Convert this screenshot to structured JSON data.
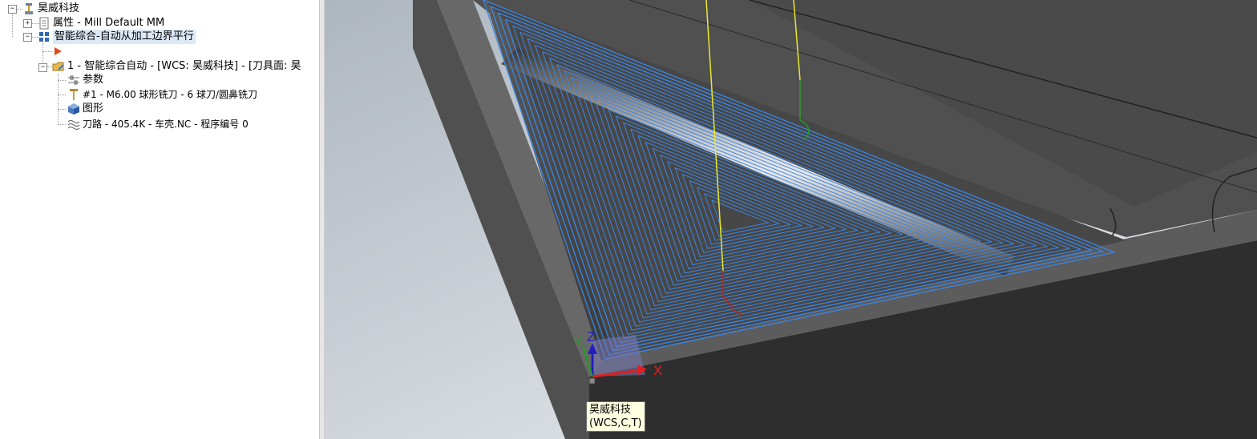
{
  "tree": {
    "root": {
      "label": "昊威科技",
      "icon": "machine-icon"
    },
    "properties": {
      "label": "属性 - Mill Default MM",
      "icon": "properties-icon"
    },
    "group": {
      "label": "智能综合-自动从加工边界平行",
      "icon": "toolpath-group-icon"
    },
    "insert_arrow": {
      "icon": "insert-arrow-icon"
    },
    "operation": {
      "label": "1 - 智能综合自动 - [WCS: 昊威科技] - [刀具面: 昊",
      "icon": "operation-folder-icon"
    },
    "children": [
      {
        "label": "参数",
        "icon": "parameters-icon"
      },
      {
        "label": "#1 - M6.00 球形铣刀 - 6 球刀/圆鼻铣刀",
        "icon": "tool-icon"
      },
      {
        "label": "图形",
        "icon": "geometry-icon"
      },
      {
        "label": "刀路 - 405.4K - 车壳.NC - 程序编号 0",
        "icon": "toolpath-icon"
      }
    ]
  },
  "viewport": {
    "axis_x": "X",
    "axis_y": "Y",
    "axis_z": "Z",
    "tooltip_line1": "昊威科技",
    "tooltip_line2": "(WCS,C,T)"
  },
  "colors": {
    "toolpath_blue": "#3a86e8",
    "feed_yellow": "#e8e830",
    "plunge_green": "#2a9a2a",
    "retract_red": "#c02020",
    "part_dark": "#4a4a4a",
    "tree_selection": "#dce8f6"
  }
}
